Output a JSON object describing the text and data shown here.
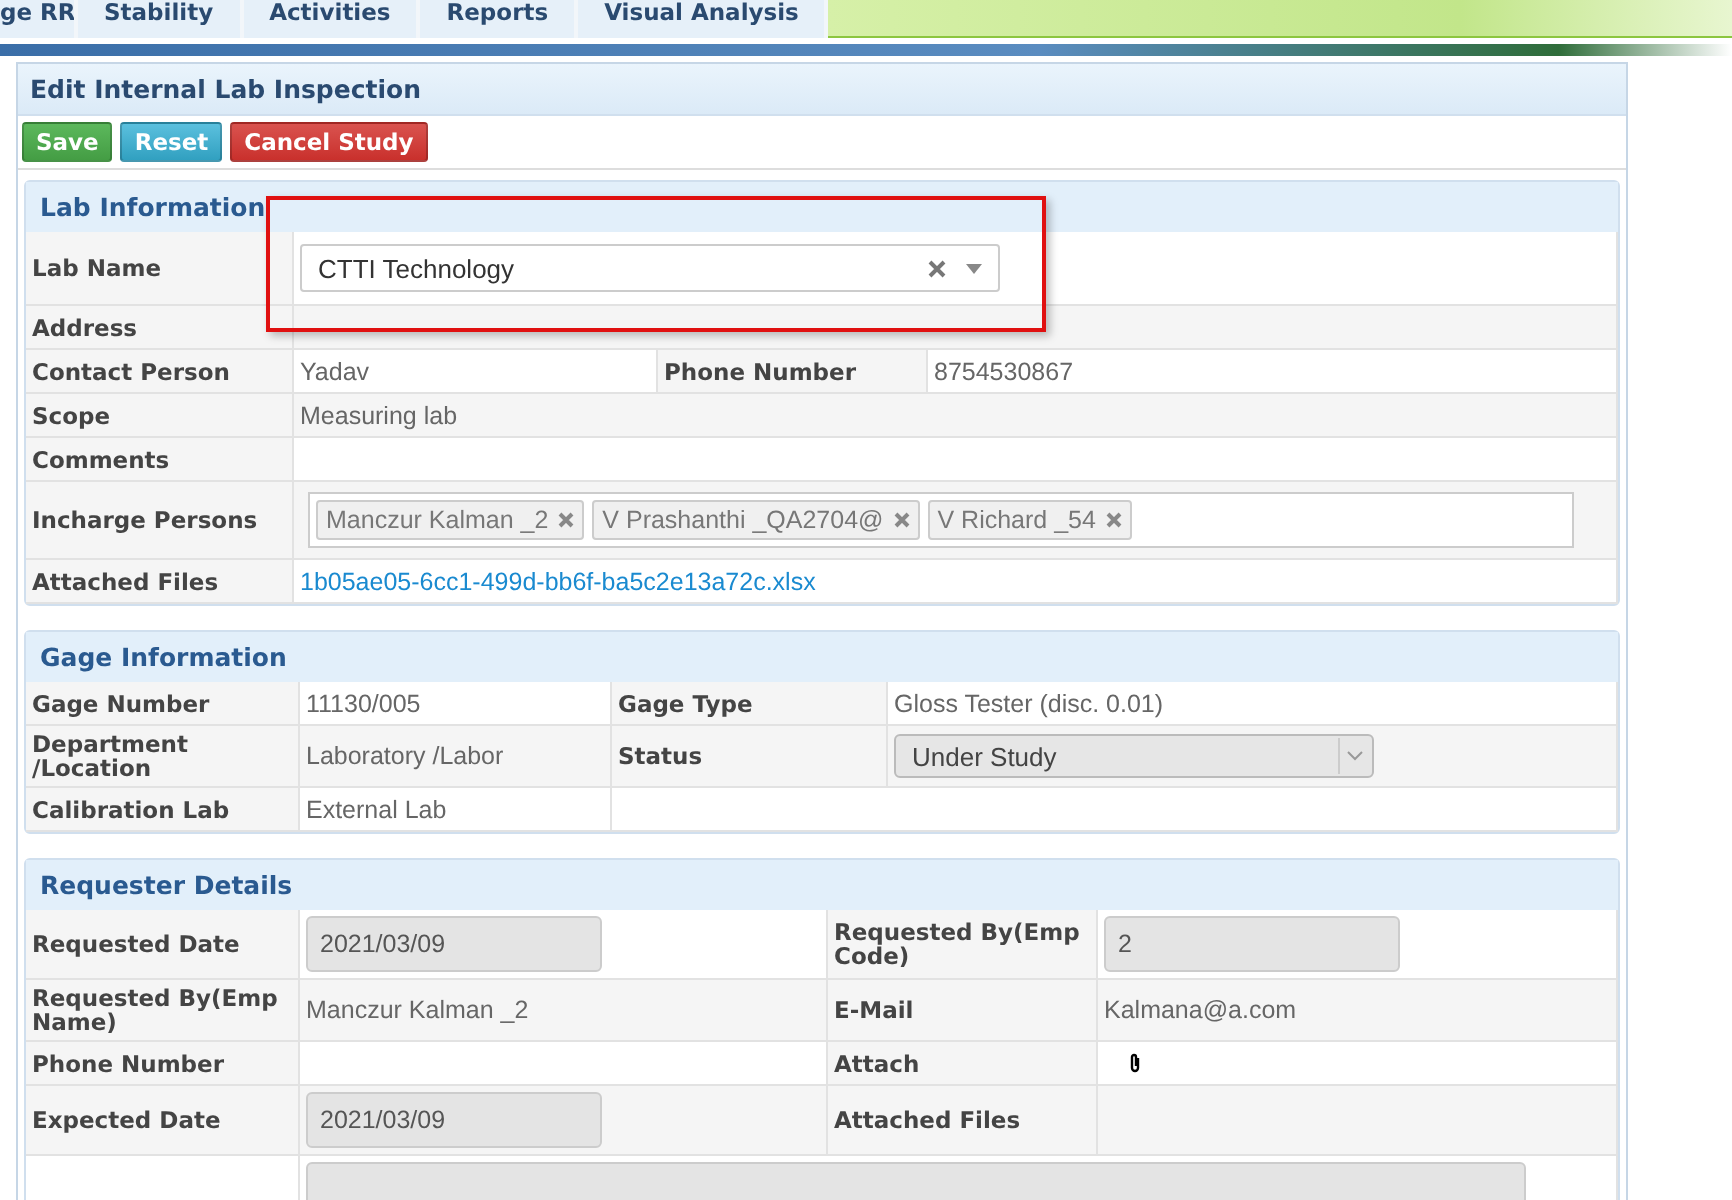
{
  "nav_tabs": [
    {
      "label": "ge RR"
    },
    {
      "label": "Stability"
    },
    {
      "label": "Activities"
    },
    {
      "label": "Reports"
    },
    {
      "label": "Visual Analysis"
    }
  ],
  "form": {
    "title": "Edit Internal Lab Inspection",
    "buttons": [
      {
        "label": "Save",
        "kind": "success"
      },
      {
        "label": "Reset",
        "kind": "info"
      },
      {
        "label": "Cancel Study",
        "kind": "danger"
      }
    ]
  },
  "sections": [
    {
      "title": "Lab Information",
      "rows": [
        {
          "cells": [
            {
              "kind": "label",
              "text": "Lab Name"
            },
            {
              "kind": "combo",
              "value": "CTTI Technology",
              "highlighted": true
            }
          ]
        },
        {
          "cells": [
            {
              "kind": "label",
              "text": "Address"
            },
            {
              "kind": "empty"
            }
          ]
        },
        {
          "cells": [
            {
              "kind": "label",
              "text": "Contact Person"
            },
            {
              "kind": "text",
              "text": "Yadav"
            },
            {
              "kind": "label",
              "text": "Phone Number"
            },
            {
              "kind": "text",
              "text": "8754530867"
            }
          ]
        },
        {
          "cells": [
            {
              "kind": "label",
              "text": "Scope"
            },
            {
              "kind": "text",
              "text": "Measuring lab"
            }
          ]
        },
        {
          "cells": [
            {
              "kind": "label",
              "text": "Comments"
            },
            {
              "kind": "empty"
            }
          ]
        },
        {
          "cells": [
            {
              "kind": "label",
              "text": "Incharge Persons"
            },
            {
              "kind": "tags",
              "tags": [
                "Manczur Kalman _2",
                "V Prashanthi _QA2704@",
                "V Richard _54"
              ]
            }
          ]
        },
        {
          "cells": [
            {
              "kind": "label",
              "text": "Attached Files"
            },
            {
              "kind": "link",
              "text": "1b05ae05-6cc1-499d-bb6f-ba5c2e13a72c.xlsx"
            }
          ]
        }
      ]
    },
    {
      "title": "Gage Information",
      "rows": [
        {
          "cells": [
            {
              "kind": "label",
              "text": "Gage Number"
            },
            {
              "kind": "text",
              "text": "11130/005"
            },
            {
              "kind": "label",
              "text": "Gage Type"
            },
            {
              "kind": "text",
              "text": "Gloss Tester (disc. 0.01)"
            }
          ]
        },
        {
          "cells": [
            {
              "kind": "label",
              "text": "Department /Location"
            },
            {
              "kind": "text",
              "text": "Laboratory /Labor"
            },
            {
              "kind": "label",
              "text": "Status"
            },
            {
              "kind": "select",
              "value": "Under Study",
              "disabled": true
            }
          ]
        },
        {
          "cells": [
            {
              "kind": "label",
              "text": "Calibration Lab"
            },
            {
              "kind": "text",
              "text": "External Lab"
            },
            {
              "kind": "empty"
            }
          ]
        }
      ]
    },
    {
      "title": "Requester Details",
      "rows": [
        {
          "cells": [
            {
              "kind": "label",
              "text": "Requested Date"
            },
            {
              "kind": "input",
              "value": "2021/03/09"
            },
            {
              "kind": "label",
              "text": "Requested By(Emp Code)"
            },
            {
              "kind": "input",
              "value": "2"
            }
          ]
        },
        {
          "cells": [
            {
              "kind": "label",
              "text": "Requested By(Emp Name)"
            },
            {
              "kind": "text",
              "text": "Manczur Kalman _2"
            },
            {
              "kind": "label",
              "text": "E-Mail"
            },
            {
              "kind": "text",
              "text": "Kalmana@a.com"
            }
          ]
        },
        {
          "cells": [
            {
              "kind": "label",
              "text": "Phone Number"
            },
            {
              "kind": "empty"
            },
            {
              "kind": "label",
              "text": "Attach"
            },
            {
              "kind": "attach"
            }
          ]
        },
        {
          "cells": [
            {
              "kind": "label",
              "text": "Expected Date"
            },
            {
              "kind": "input",
              "value": "2021/03/09"
            },
            {
              "kind": "label",
              "text": "Attached Files"
            },
            {
              "kind": "empty"
            }
          ]
        },
        {
          "cells": [
            {
              "kind": "empty"
            },
            {
              "kind": "textarea"
            }
          ]
        }
      ]
    }
  ]
}
